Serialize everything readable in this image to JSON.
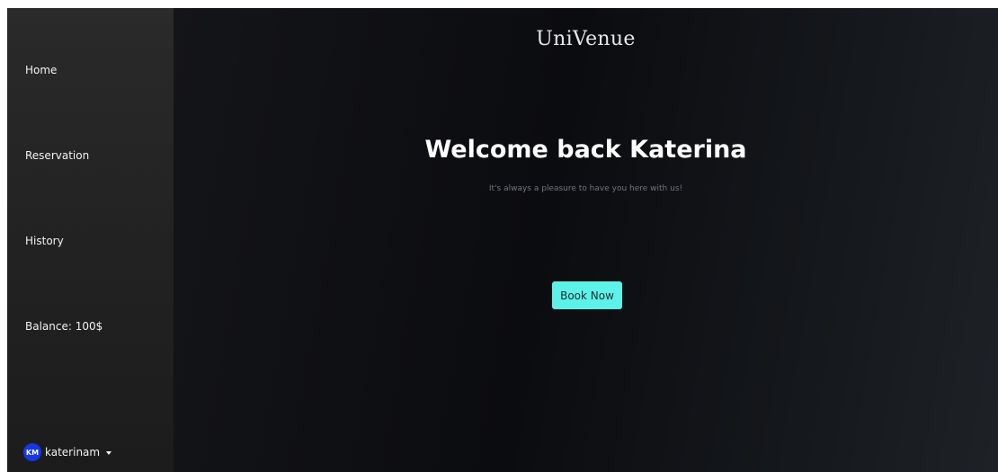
{
  "sidebar": {
    "items": [
      {
        "label": "Home"
      },
      {
        "label": "Reservation"
      },
      {
        "label": "History"
      }
    ],
    "balance_label": "Balance: 100$",
    "user": {
      "initials": "KM",
      "username": "katerinam",
      "avatar_color": "#1537e6"
    }
  },
  "main": {
    "brand": "UniVenue",
    "welcome": "Welcome back Katerina",
    "subtitle": "It's always a pleasure to have you here with us!",
    "book_button": "Book Now",
    "accent_color": "#5cf2e8"
  }
}
